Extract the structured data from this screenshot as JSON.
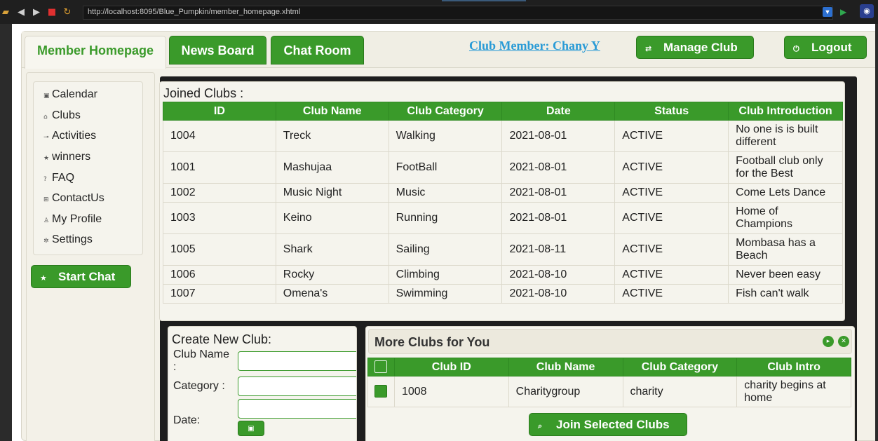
{
  "browser": {
    "url": "http://localhost:8095/Blue_Pumpkin/member_homepage.xhtml"
  },
  "tabs": {
    "member_homepage": "Member Homepage",
    "news_board": "News Board",
    "chat_room": "Chat Room"
  },
  "header": {
    "member_label": "Club Member: Chany Y",
    "manage_club": "Manage Club",
    "logout": "Logout"
  },
  "nav": {
    "items": [
      "Calendar",
      "Clubs",
      "Activities",
      "winners",
      "FAQ",
      "ContactUs",
      "My Profile",
      "Settings"
    ],
    "start_chat": "Start Chat"
  },
  "joined_clubs": {
    "title": "Joined Clubs :",
    "columns": [
      "ID",
      "Club Name",
      "Club Category",
      "Date",
      "Status",
      "Club Introduction"
    ],
    "rows": [
      [
        "1004",
        "Treck",
        "Walking",
        "2021-08-01",
        "ACTIVE",
        "No one is is built different"
      ],
      [
        "1001",
        "Mashujaa",
        "FootBall",
        "2021-08-01",
        "ACTIVE",
        "Football club only for the Best"
      ],
      [
        "1002",
        "Music Night",
        "Music",
        "2021-08-01",
        "ACTIVE",
        "Come Lets Dance"
      ],
      [
        "1003",
        "Keino",
        "Running",
        "2021-08-01",
        "ACTIVE",
        "Home of Champions"
      ],
      [
        "1005",
        "Shark",
        "Sailing",
        "2021-08-11",
        "ACTIVE",
        "Mombasa has a Beach"
      ],
      [
        "1006",
        "Rocky",
        "Climbing",
        "2021-08-10",
        "ACTIVE",
        "Never been easy"
      ],
      [
        "1007",
        "Omena's",
        "Swimming",
        "2021-08-10",
        "ACTIVE",
        "Fish can't walk"
      ]
    ]
  },
  "create_club": {
    "title": "Create New Club:",
    "club_name_label": "Club Name :",
    "category_label": "Category :",
    "date_label": "Date:",
    "club_name_value": "",
    "category_value": "",
    "date_value": ""
  },
  "more_clubs": {
    "title": "More Clubs for You",
    "columns": [
      "Club ID",
      "Club Name",
      "Club Category",
      "Club Intro"
    ],
    "rows": [
      [
        "1008",
        "Charitygroup",
        "charity",
        "charity begins at home"
      ]
    ],
    "join_button": "Join Selected Clubs"
  },
  "colors": {
    "accent": "#3a9a2a",
    "link": "#2a9bd6",
    "panel": "#f5f4ed"
  }
}
